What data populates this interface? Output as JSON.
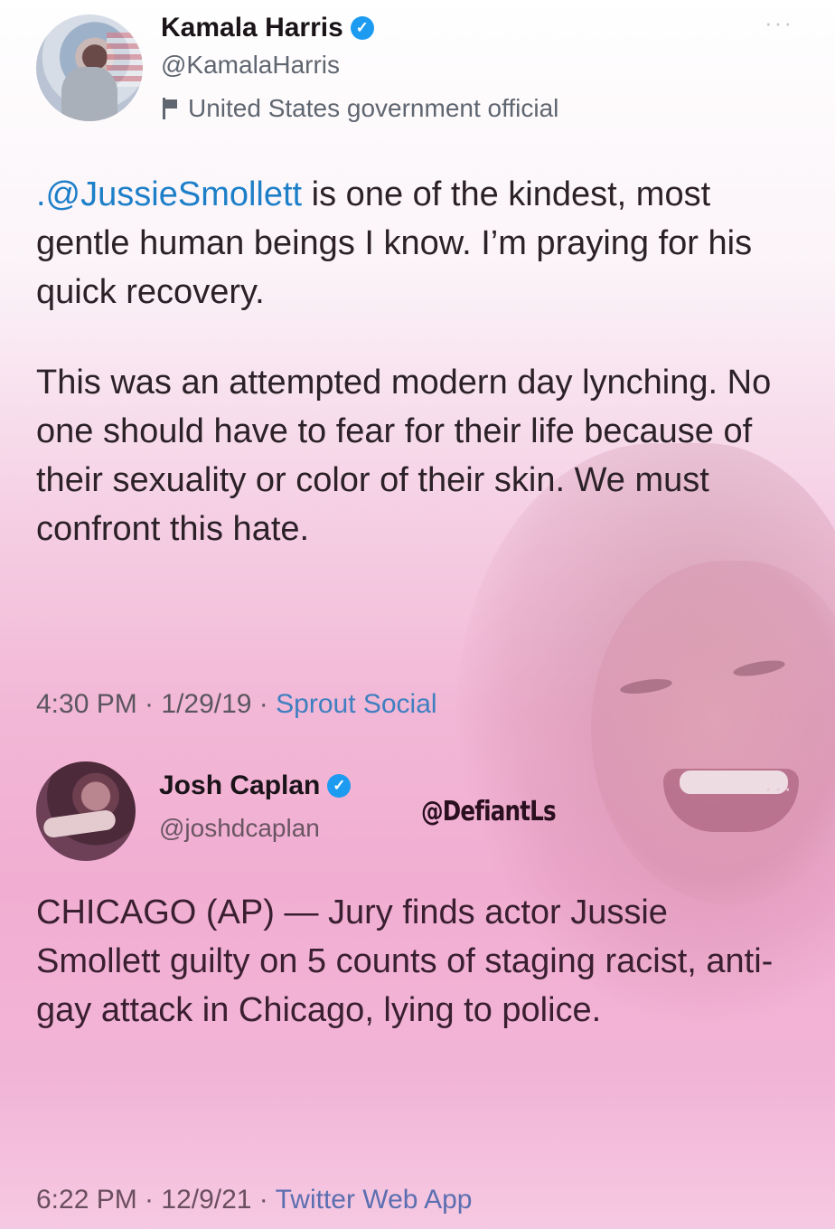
{
  "tweet1": {
    "name": "Kamala Harris",
    "handle": "@KamalaHarris",
    "label": "United States government official",
    "more": "···",
    "paragraph1_mention": ".@JussieSmollett",
    "paragraph1_rest": " is one of the kindest, most gentle human beings I know. I’m praying for his quick recovery.",
    "paragraph2": "This was an attempted modern day lynching. No one should have to fear for their life because of their sexuality or color of their skin. We must confront this hate.",
    "time": "4:30 PM · 1/29/19 · ",
    "source": "Sprout Social"
  },
  "tweet2": {
    "name": "Josh Caplan",
    "handle": "@joshdcaplan",
    "more": "···",
    "text": "CHICAGO (AP) — Jury finds actor Jussie Smollett guilty on 5 counts of staging racist, anti-gay attack in Chicago, lying to police.",
    "time": "6:22 PM · 12/9/21 · ",
    "source": "Twitter Web App"
  },
  "watermark": "@DefiantLs",
  "icons": {
    "verified": "verified-badge-icon",
    "flag": "flag-icon",
    "more": "more-options-icon"
  },
  "colors": {
    "mention": "#1d7fc8",
    "verified": "#1d9bf0",
    "pink_overlay": "#f2b7d6"
  }
}
